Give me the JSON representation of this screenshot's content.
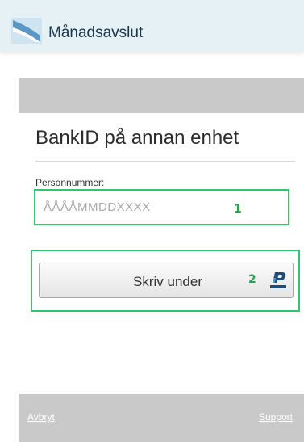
{
  "app_bar": {
    "logo_icon": "brand-logo-icon",
    "title": "Månadsavslut",
    "background": "#e6f1f6"
  },
  "card": {
    "heading": "BankID på annan enhet",
    "personnummer": {
      "label": "Personnummer:",
      "placeholder": "ÅÅÅÅMMDDXXXX",
      "value": ""
    },
    "sign_button": {
      "label": "Skriv under",
      "icon": "bankid-icon"
    },
    "footer": {
      "cancel_label": "Avbryt",
      "support_label": "Support"
    }
  },
  "annotations": {
    "marker_1": "1",
    "marker_2": "2",
    "highlight_color": "#30c76e"
  }
}
